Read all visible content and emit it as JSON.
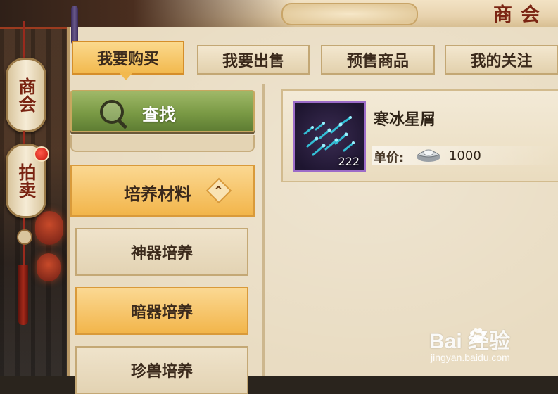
{
  "header": {
    "title": "商会"
  },
  "side_nav": [
    {
      "label": "商会",
      "selected": true
    },
    {
      "label": "拍卖",
      "has_notification": true
    }
  ],
  "tabs": [
    {
      "label": "我要购买",
      "active": true
    },
    {
      "label": "我要出售",
      "active": false
    },
    {
      "label": "预售商品",
      "active": false
    },
    {
      "label": "我的关注",
      "active": false
    }
  ],
  "search": {
    "label": "查找"
  },
  "category": {
    "label": "培养材料",
    "expanded": true
  },
  "subcategories": [
    {
      "label": "神器培养",
      "active": false
    },
    {
      "label": "暗器培养",
      "active": true
    },
    {
      "label": "珍兽培养",
      "active": false
    }
  ],
  "listing": {
    "item_name": "寒冰星屑",
    "quantity": "222",
    "price_label": "单价:",
    "price_value": "1000",
    "currency_icon": "silver-ingot-icon"
  },
  "watermark": {
    "brand": "Bai  经验",
    "url": "jingyan.baidu.com"
  },
  "colors": {
    "accent_orange": "#f2b54a",
    "search_green": "#7a9a45",
    "title_red": "#7a2412",
    "rare_purple": "#9c6cc8"
  }
}
